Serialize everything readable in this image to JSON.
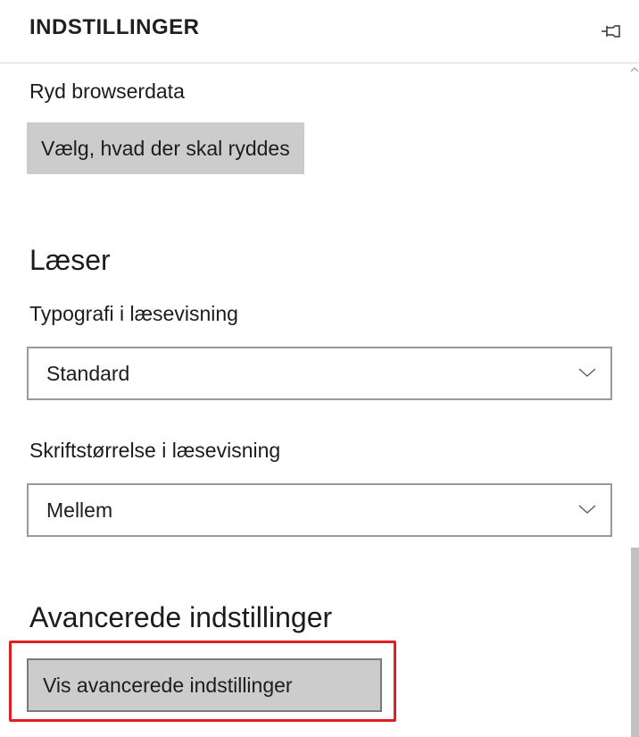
{
  "header": {
    "title": "INDSTILLINGER",
    "pin_icon": "pin-icon"
  },
  "clear_data": {
    "label": "Ryd browserdata",
    "button_label": "Vælg, hvad der skal ryddes"
  },
  "reader": {
    "heading": "Læser",
    "typography_label": "Typografi i læsevisning",
    "typography_value": "Standard",
    "font_size_label": "Skriftstørrelse i læsevisning",
    "font_size_value": "Mellem"
  },
  "advanced": {
    "heading": "Avancerede indstillinger",
    "button_label": "Vis avancerede indstillinger"
  },
  "colors": {
    "highlight": "#e02020",
    "button_bg": "#cccccc",
    "scroll_thumb": "#c2c2c2"
  }
}
